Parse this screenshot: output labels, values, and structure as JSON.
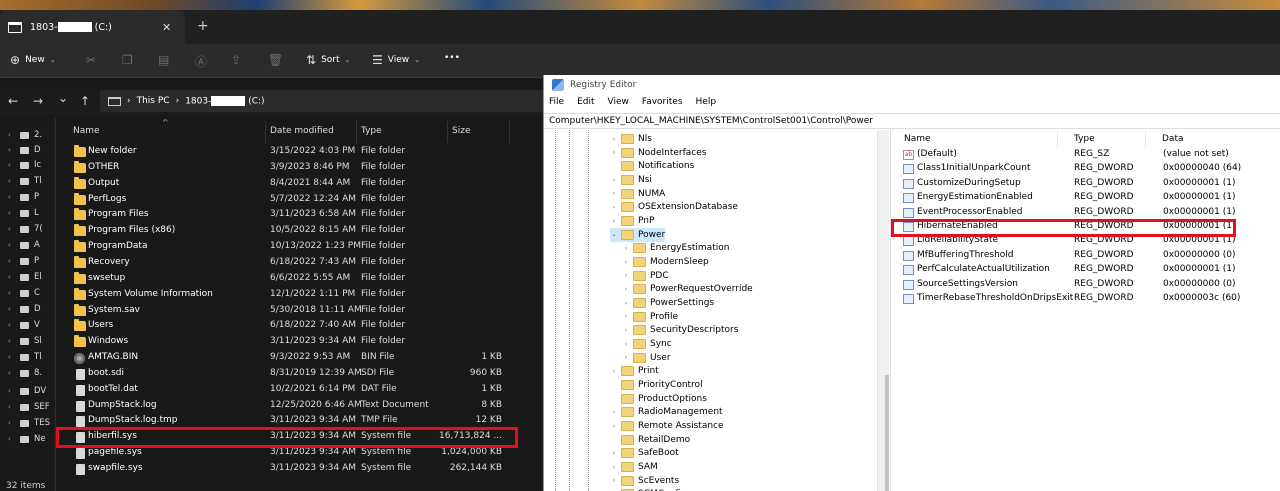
{
  "explorer": {
    "tab_title_prefix": "1803-",
    "tab_title_suffix": "(C:)",
    "tab_close": "✕",
    "new_tab": "+",
    "toolbar": {
      "new_label": "New",
      "sort_label": "Sort",
      "view_label": "View",
      "more_label": "•••"
    },
    "nav": {
      "back": "←",
      "forward": "→",
      "recent": "⌄",
      "up": "↑"
    },
    "breadcrumb": {
      "this_pc": "This PC",
      "sep1": "›",
      "sep2": "›",
      "drive_prefix": "1803-",
      "drive_suffix": "(C:)"
    },
    "columns": {
      "name": "Name",
      "date": "Date modified",
      "type": "Type",
      "size": "Size"
    },
    "sidebar": [
      {
        "label": "2."
      },
      {
        "label": "D"
      },
      {
        "label": "Ic"
      },
      {
        "label": "Tl"
      },
      {
        "label": "P"
      },
      {
        "label": "L"
      },
      {
        "label": "7("
      },
      {
        "label": "A"
      },
      {
        "label": "P"
      },
      {
        "label": "El"
      },
      {
        "label": "C"
      },
      {
        "label": "D"
      },
      {
        "label": "V"
      },
      {
        "label": "Sl"
      },
      {
        "label": "Tl"
      },
      {
        "label": "8."
      },
      {
        "label": "DV"
      },
      {
        "label": "SEF"
      },
      {
        "label": "TES"
      },
      {
        "label": "Ne"
      }
    ],
    "files": [
      {
        "name": "New folder",
        "date": "3/15/2022 4:03 PM",
        "type": "File folder",
        "size": "",
        "kind": "folder"
      },
      {
        "name": "OTHER",
        "date": "3/9/2023 8:46 PM",
        "type": "File folder",
        "size": "",
        "kind": "folder"
      },
      {
        "name": "Output",
        "date": "8/4/2021 8:44 AM",
        "type": "File folder",
        "size": "",
        "kind": "folder"
      },
      {
        "name": "PerfLogs",
        "date": "5/7/2022 12:24 AM",
        "type": "File folder",
        "size": "",
        "kind": "folder"
      },
      {
        "name": "Program Files",
        "date": "3/11/2023 6:58 AM",
        "type": "File folder",
        "size": "",
        "kind": "folder"
      },
      {
        "name": "Program Files (x86)",
        "date": "10/5/2022 8:15 AM",
        "type": "File folder",
        "size": "",
        "kind": "folder"
      },
      {
        "name": "ProgramData",
        "date": "10/13/2022 1:23 PM",
        "type": "File folder",
        "size": "",
        "kind": "folder"
      },
      {
        "name": "Recovery",
        "date": "6/18/2022 7:43 AM",
        "type": "File folder",
        "size": "",
        "kind": "folder"
      },
      {
        "name": "swsetup",
        "date": "6/6/2022 5:55 AM",
        "type": "File folder",
        "size": "",
        "kind": "folder"
      },
      {
        "name": "System Volume Information",
        "date": "12/1/2022 1:11 PM",
        "type": "File folder",
        "size": "",
        "kind": "folder"
      },
      {
        "name": "System.sav",
        "date": "5/30/2018 11:11 AM",
        "type": "File folder",
        "size": "",
        "kind": "folder"
      },
      {
        "name": "Users",
        "date": "6/18/2022 7:40 AM",
        "type": "File folder",
        "size": "",
        "kind": "folder"
      },
      {
        "name": "Windows",
        "date": "3/11/2023 9:34 AM",
        "type": "File folder",
        "size": "",
        "kind": "folder"
      },
      {
        "name": "AMTAG.BIN",
        "date": "9/3/2022 9:53 AM",
        "type": "BIN File",
        "size": "1 KB",
        "kind": "bin"
      },
      {
        "name": "boot.sdi",
        "date": "8/31/2019 12:39 AM",
        "type": "SDI File",
        "size": "960 KB",
        "kind": "file"
      },
      {
        "name": "bootTel.dat",
        "date": "10/2/2021 6:14 PM",
        "type": "DAT File",
        "size": "1 KB",
        "kind": "file"
      },
      {
        "name": "DumpStack.log",
        "date": "12/25/2020 6:46 AM",
        "type": "Text Document",
        "size": "8 KB",
        "kind": "file"
      },
      {
        "name": "DumpStack.log.tmp",
        "date": "3/11/2023 9:34 AM",
        "type": "TMP File",
        "size": "12 KB",
        "kind": "file"
      },
      {
        "name": "hiberfil.sys",
        "date": "3/11/2023 9:34 AM",
        "type": "System file",
        "size": "16,713,824 ...",
        "kind": "file"
      },
      {
        "name": "pagefile.sys",
        "date": "3/11/2023 9:34 AM",
        "type": "System file",
        "size": "1,024,000 KB",
        "kind": "file"
      },
      {
        "name": "swapfile.sys",
        "date": "3/11/2023 9:34 AM",
        "type": "System file",
        "size": "262,144 KB",
        "kind": "file"
      }
    ],
    "status": "32 items"
  },
  "registry": {
    "title": "Registry Editor",
    "menu": [
      "File",
      "Edit",
      "View",
      "Favorites",
      "Help"
    ],
    "path": "Computer\\HKEY_LOCAL_MACHINE\\SYSTEM\\ControlSet001\\Control\\Power",
    "tree": [
      {
        "label": "Nls",
        "depth": 0,
        "expand": "›"
      },
      {
        "label": "NodeInterfaces",
        "depth": 0,
        "expand": "›"
      },
      {
        "label": "Notifications",
        "depth": 0,
        "expand": ""
      },
      {
        "label": "Nsi",
        "depth": 0,
        "expand": "›"
      },
      {
        "label": "NUMA",
        "depth": 0,
        "expand": "›"
      },
      {
        "label": "OSExtensionDatabase",
        "depth": 0,
        "expand": "›"
      },
      {
        "label": "PnP",
        "depth": 0,
        "expand": "›"
      },
      {
        "label": "Power",
        "depth": 0,
        "expand": "⌄",
        "selected": true
      },
      {
        "label": "EnergyEstimation",
        "depth": 1,
        "expand": "›"
      },
      {
        "label": "ModernSleep",
        "depth": 1,
        "expand": "›"
      },
      {
        "label": "PDC",
        "depth": 1,
        "expand": "›"
      },
      {
        "label": "PowerRequestOverride",
        "depth": 1,
        "expand": "›"
      },
      {
        "label": "PowerSettings",
        "depth": 1,
        "expand": "›"
      },
      {
        "label": "Profile",
        "depth": 1,
        "expand": "›"
      },
      {
        "label": "SecurityDescriptors",
        "depth": 1,
        "expand": "›"
      },
      {
        "label": "Sync",
        "depth": 1,
        "expand": "›"
      },
      {
        "label": "User",
        "depth": 1,
        "expand": "›"
      },
      {
        "label": "Print",
        "depth": 0,
        "expand": "›"
      },
      {
        "label": "PriorityControl",
        "depth": 0,
        "expand": ""
      },
      {
        "label": "ProductOptions",
        "depth": 0,
        "expand": ""
      },
      {
        "label": "RadioManagement",
        "depth": 0,
        "expand": "›"
      },
      {
        "label": "Remote Assistance",
        "depth": 0,
        "expand": "›"
      },
      {
        "label": "RetailDemo",
        "depth": 0,
        "expand": ""
      },
      {
        "label": "SafeBoot",
        "depth": 0,
        "expand": "›"
      },
      {
        "label": "SAM",
        "depth": 0,
        "expand": "›"
      },
      {
        "label": "ScEvents",
        "depth": 0,
        "expand": "›"
      },
      {
        "label": "SCMConfig",
        "depth": 0,
        "expand": ""
      }
    ],
    "columns": {
      "name": "Name",
      "type": "Type",
      "data": "Data"
    },
    "values": [
      {
        "name": "(Default)",
        "type": "REG_SZ",
        "data": "(value not set)",
        "icon": "ab"
      },
      {
        "name": "Class1InitialUnparkCount",
        "type": "REG_DWORD",
        "data": "0x00000040 (64)",
        "icon": "dword"
      },
      {
        "name": "CustomizeDuringSetup",
        "type": "REG_DWORD",
        "data": "0x00000001 (1)",
        "icon": "dword"
      },
      {
        "name": "EnergyEstimationEnabled",
        "type": "REG_DWORD",
        "data": "0x00000001 (1)",
        "icon": "dword"
      },
      {
        "name": "EventProcessorEnabled",
        "type": "REG_DWORD",
        "data": "0x00000001 (1)",
        "icon": "dword"
      },
      {
        "name": "HibernateEnabled",
        "type": "REG_DWORD",
        "data": "0x00000001 (1)",
        "icon": "dword"
      },
      {
        "name": "LidReliabilityState",
        "type": "REG_DWORD",
        "data": "0x00000001 (1)",
        "icon": "dword"
      },
      {
        "name": "MfBufferingThreshold",
        "type": "REG_DWORD",
        "data": "0x00000000 (0)",
        "icon": "dword"
      },
      {
        "name": "PerfCalculateActualUtilization",
        "type": "REG_DWORD",
        "data": "0x00000001 (1)",
        "icon": "dword"
      },
      {
        "name": "SourceSettingsVersion",
        "type": "REG_DWORD",
        "data": "0x00000000 (0)",
        "icon": "dword"
      },
      {
        "name": "TimerRebaseThresholdOnDripsExit",
        "type": "REG_DWORD",
        "data": "0x0000003c (60)",
        "icon": "dword"
      }
    ]
  },
  "colors": {
    "highlight_box": "#e0101e",
    "folder": "#f1c24d",
    "tree_selected": "#cce8ff"
  }
}
